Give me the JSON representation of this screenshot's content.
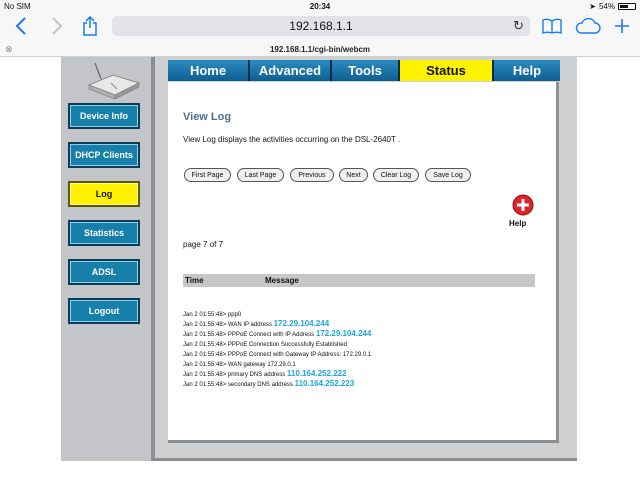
{
  "status_bar": {
    "carrier": "No SIM",
    "time": "20:34",
    "battery": "54%",
    "battery_level": 0.54
  },
  "browser": {
    "url": "192.168.1.1",
    "tab_title": "192.168.1.1/cgi-bin/webcm",
    "icons": {
      "back": "chevron-left-icon",
      "forward": "chevron-right-icon",
      "share": "share-icon",
      "reload": "reload-icon",
      "bookmarks": "book-icon",
      "cloud": "cloud-icon",
      "new_tab": "plus-icon",
      "close_tab": "close-icon"
    }
  },
  "sidebar": {
    "items": [
      {
        "label": "Device Info",
        "active": false
      },
      {
        "label": "DHCP Clients",
        "active": false
      },
      {
        "label": "Log",
        "active": true
      },
      {
        "label": "Statistics",
        "active": false
      },
      {
        "label": "ADSL",
        "active": false
      },
      {
        "label": "Logout",
        "active": false
      }
    ]
  },
  "tabs": [
    {
      "label": "Home",
      "active": false
    },
    {
      "label": "Advanced",
      "active": false
    },
    {
      "label": "Tools",
      "active": false
    },
    {
      "label": "Status",
      "active": true
    },
    {
      "label": "Help",
      "active": false
    }
  ],
  "content": {
    "title": "View Log",
    "description": "View Log displays the activities occurring on the DSL-2640T .",
    "buttons": [
      "First Page",
      "Last Page",
      "Previous",
      "Next",
      "Clear Log",
      "Save Log"
    ],
    "help_label": "Help",
    "page_label": "page 7 of 7",
    "log_columns": [
      "Time",
      "Message"
    ],
    "log_entries": [
      {
        "prefix": "Jan 2 01:55:48>",
        "message": "ppp0",
        "ip": ""
      },
      {
        "prefix": "Jan 2 01:55:48>",
        "message": "WAN IP address",
        "ip": "172.29.104.244"
      },
      {
        "prefix": "Jan 2 01:55:48>",
        "message": "PPPoE Connect with IP Address",
        "ip": "172.29.104.244"
      },
      {
        "prefix": "Jan 2 01:55:48>",
        "message": "PPPoE Connection Successfully Established",
        "ip": ""
      },
      {
        "prefix": "Jan 2 01:55:48>",
        "message": "PPPoE Connect with Gateway IP Address: 172.29.0.1",
        "ip": ""
      },
      {
        "prefix": "Jan 2 01:55:48>",
        "message": "WAN gateway 172.29.0.1",
        "ip": ""
      },
      {
        "prefix": "Jan 2 01:55:48>",
        "message": "primary DNS address",
        "ip": "110.164.252.222"
      },
      {
        "prefix": "Jan 2 01:55:48>",
        "message": "secondary DNS address",
        "ip": "110.164.252.223"
      }
    ]
  },
  "colors": {
    "ios_blue": "#1a7bf2",
    "nav_blue": "#1680aa",
    "active_yellow": "#fff200",
    "ip_highlight": "#19a6e0",
    "title_blue": "#4a6f8f"
  }
}
